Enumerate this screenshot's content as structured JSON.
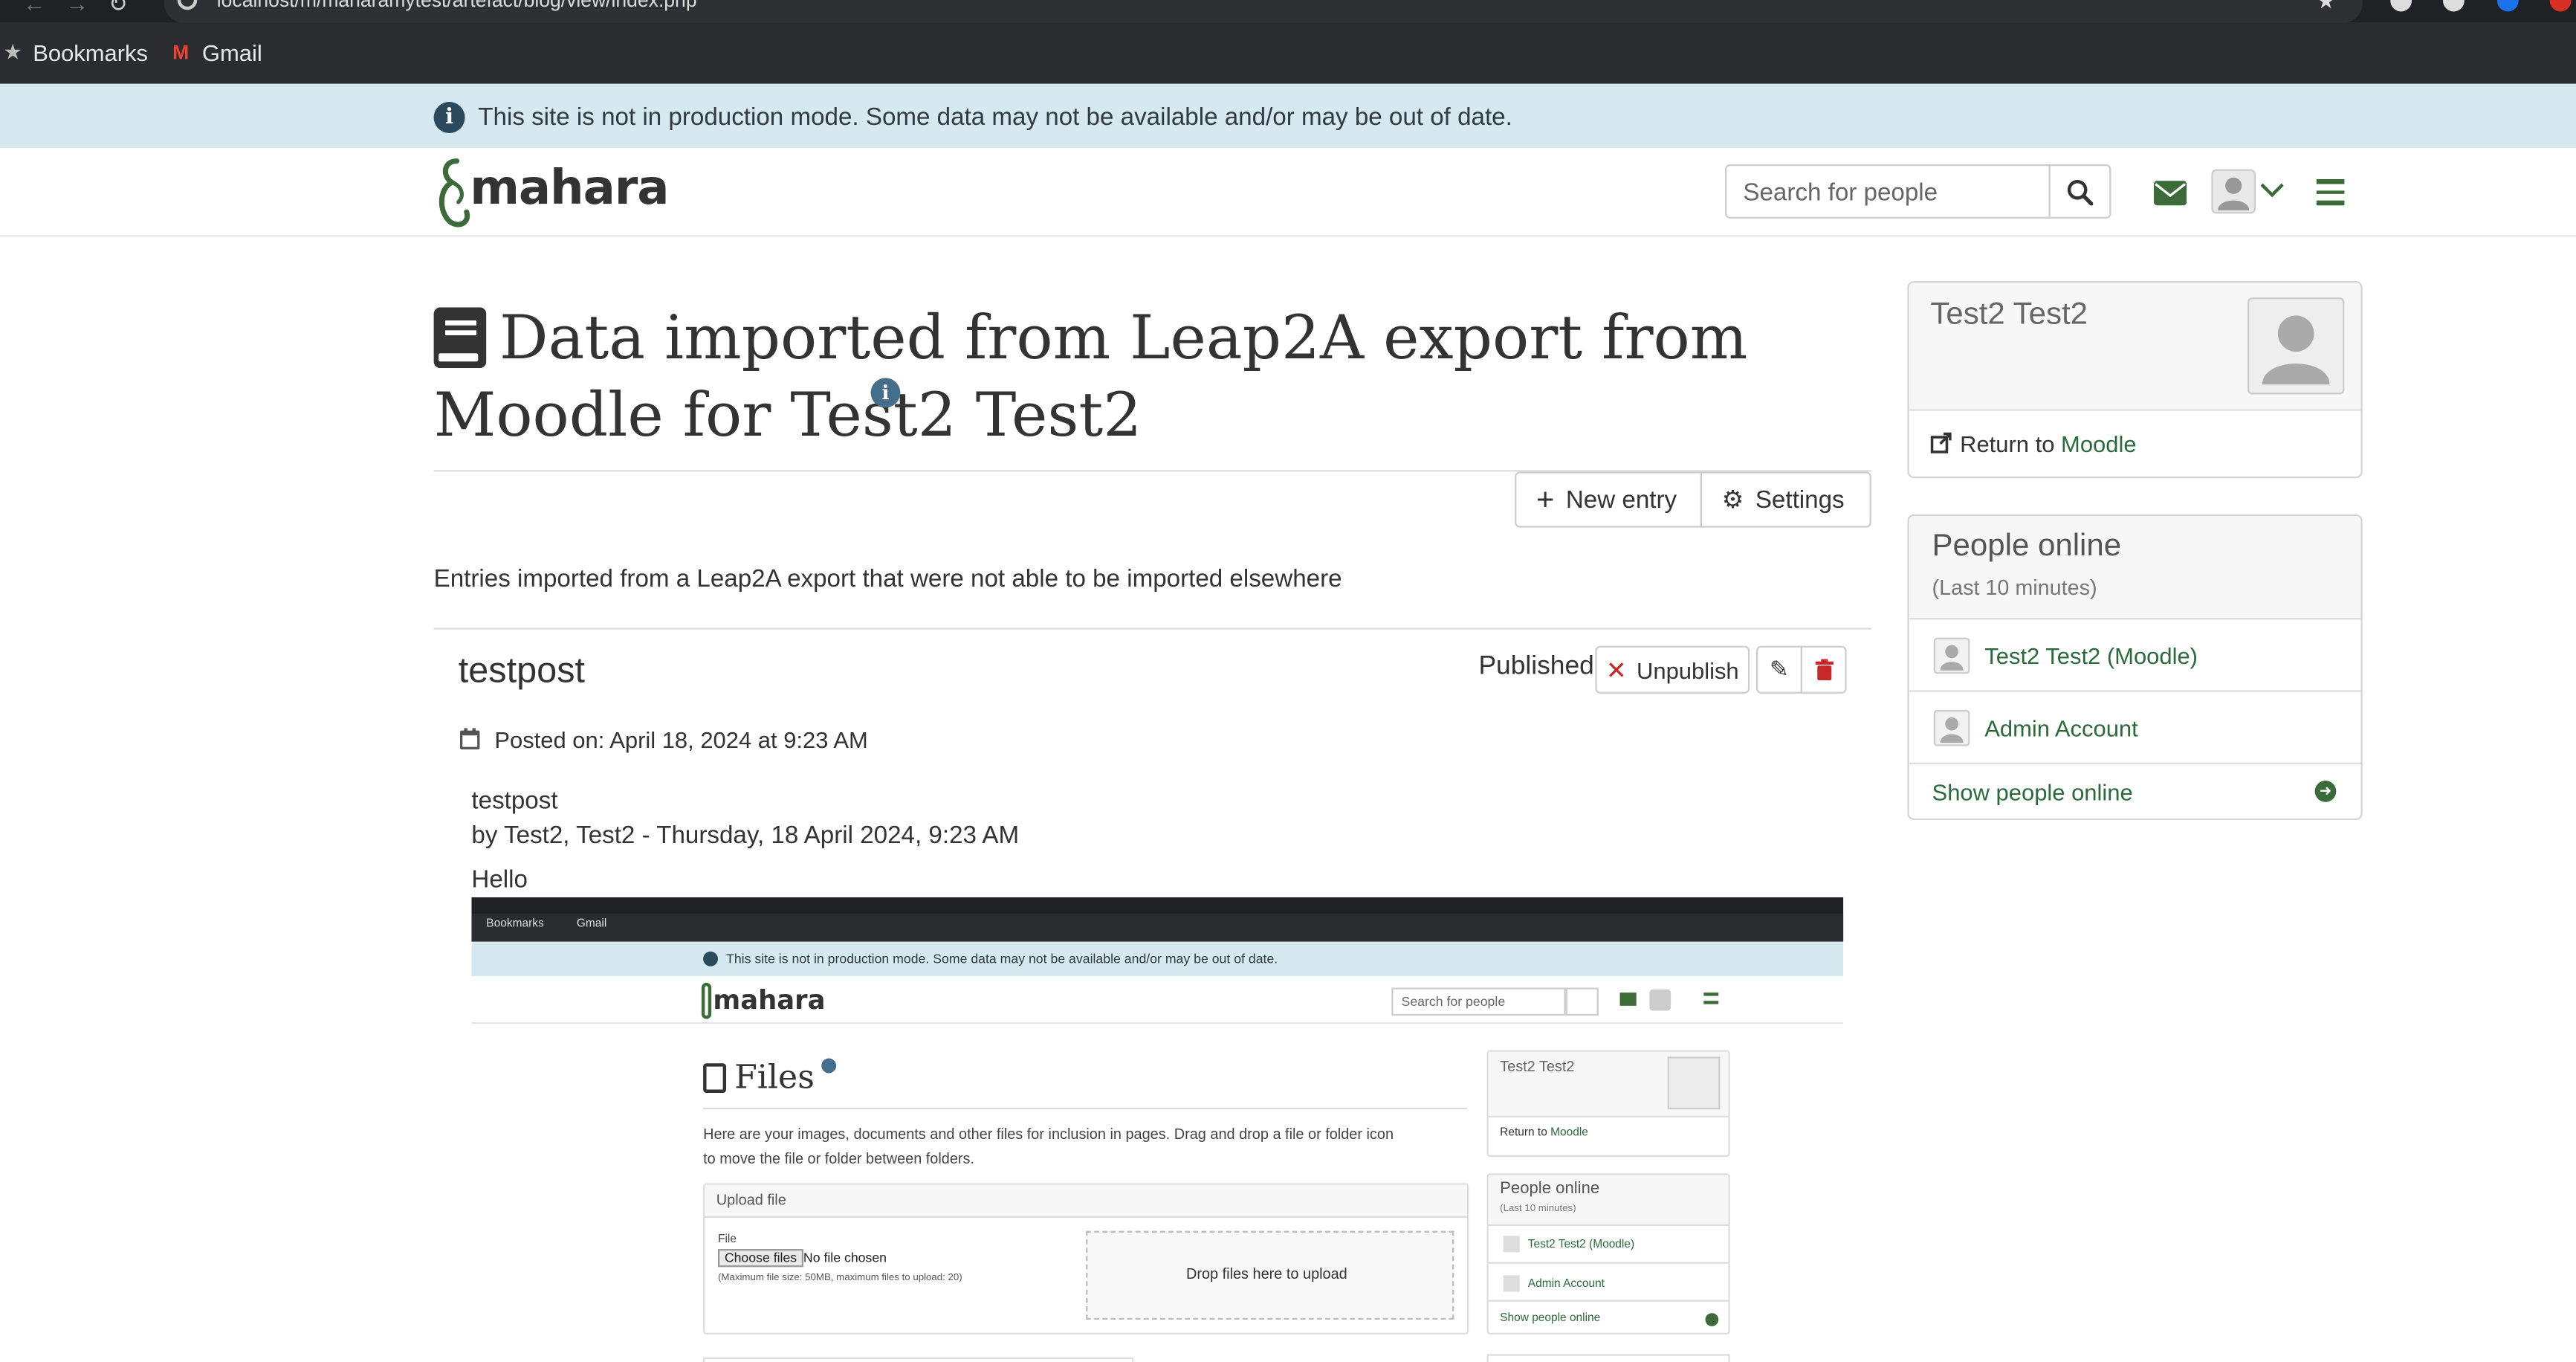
{
  "browser": {
    "url": "localhost/m/maharamytest/artefact/blog/view/index.php",
    "bookmarks": [
      {
        "label": "Bookmarks"
      },
      {
        "label": "Gmail"
      }
    ]
  },
  "notice": {
    "text": "This site is not in production mode. Some data may not be available and/or may be out of date."
  },
  "header": {
    "logo": "mahara",
    "search_placeholder": "Search for people"
  },
  "page": {
    "title": "Data imported from Leap2A export from Moodle for Test2 Test2",
    "new_entry": "New entry",
    "settings": "Settings",
    "description": "Entries imported from a Leap2A export that were not able to be imported elsewhere"
  },
  "post": {
    "title": "testpost",
    "status": "Published",
    "unpublish": "Unpublish",
    "posted_on": "Posted on: April 18, 2024 at 9:23 AM",
    "body_title": "testpost",
    "byline": "by Test2, Test2 - Thursday, 18 April 2024, 9:23 AM",
    "body": "Hello"
  },
  "sidebar": {
    "profile_name": "Test2 Test2",
    "return_prefix": "Return to",
    "return_link": "Moodle",
    "online_title": "People online",
    "online_subtitle": "(Last 10 minutes)",
    "people": [
      {
        "name": "Test2 Test2 (Moodle)"
      },
      {
        "name": "Admin Account"
      }
    ],
    "show_online": "Show people online"
  },
  "embedded": {
    "bookmarks": [
      {
        "label": "Bookmarks"
      },
      {
        "label": "Gmail"
      }
    ],
    "notice": "This site is not in production mode. Some data may not be available and/or may be out of date.",
    "logo": "mahara",
    "search_placeholder": "Search for people",
    "files_title": "Files",
    "files_desc_1": "Here are your images, documents and other files for inclusion in pages. Drag and drop a file or folder icon",
    "files_desc_2": "to move the file or folder between folders.",
    "upload_title": "Upload file",
    "file_label": "File",
    "choose_files": "Choose files",
    "no_file": "No file chosen",
    "max_size": "(Maximum file size: 50MB, maximum files to upload: 20)",
    "drop_files": "Drop files here to upload",
    "profile_name": "Test2 Test2",
    "return_prefix": "Return to",
    "return_link": "Moodle",
    "online_title": "People online",
    "online_subtitle": "(Last 10 minutes)",
    "people": [
      {
        "name": "Test2 Test2 (Moodle)"
      },
      {
        "name": "Admin Account"
      }
    ],
    "show_online": "Show people online"
  }
}
